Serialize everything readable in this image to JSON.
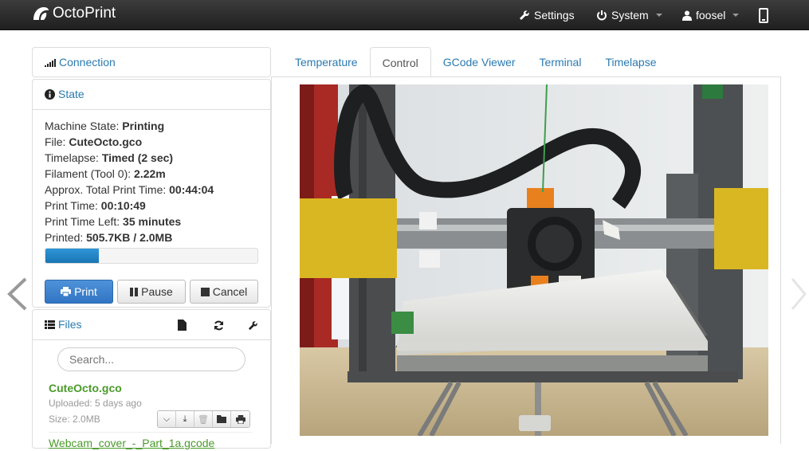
{
  "navbar": {
    "brand": "OctoPrint",
    "settings": "Settings",
    "system": "System",
    "user": "foosel"
  },
  "connection": {
    "title": "Connection"
  },
  "state": {
    "title": "State",
    "lines": [
      {
        "label": "Machine State: ",
        "value": "Printing"
      },
      {
        "label": "File: ",
        "value": "CuteOcto.gco"
      },
      {
        "label": "Timelapse: ",
        "value": "Timed (2 sec)"
      },
      {
        "label": "Filament (Tool 0): ",
        "value": "2.22m"
      },
      {
        "label": "Approx. Total Print Time: ",
        "value": "00:44:04"
      },
      {
        "label": "Print Time: ",
        "value": "00:10:49"
      },
      {
        "label": "Print Time Left: ",
        "value": "35 minutes"
      },
      {
        "label": "Printed: ",
        "value": "505.7KB / 2.0MB"
      }
    ],
    "progress_fraction": 0.25,
    "buttons": {
      "print": "Print",
      "pause": "Pause",
      "cancel": "Cancel"
    }
  },
  "files": {
    "title": "Files",
    "search_placeholder": "Search...",
    "items": [
      {
        "name": "CuteOcto.gco",
        "uploaded": "Uploaded: 5 days ago",
        "size": "Size: 2.0MB"
      },
      {
        "name": "Webcam_cover_-_Part_1a.gcode"
      }
    ]
  },
  "tabs": [
    "Temperature",
    "Control",
    "GCode Viewer",
    "Terminal",
    "Timelapse"
  ],
  "active_tab": "Control",
  "colors": {
    "navbar": "#2b2b2b",
    "link": "#2a7ab0",
    "primary": "#3f86d0",
    "file_green": "#4a9a2a"
  }
}
